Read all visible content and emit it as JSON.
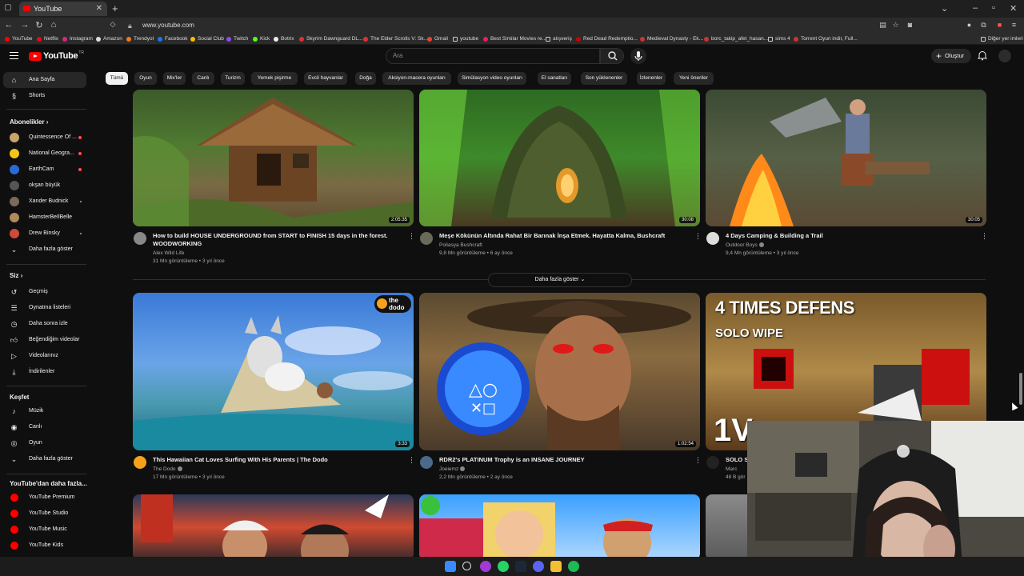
{
  "browser": {
    "tab_title": "YouTube",
    "url": "www.youtube.com",
    "bookmarks": [
      "YouTube",
      "Netflix",
      "Instagram",
      "Amazon",
      "Trendyol",
      "Facebook",
      "Social Club",
      "Twitch",
      "Kick",
      "Botrix",
      "Skyrim Dawnguard DL...",
      "The Elder Scrolls V: Sk...",
      "Gmail",
      "youtube",
      "Best Similar Movies re...",
      "alışveriş",
      "Red Dead Redemptio...",
      "Medieval Dynasty - Ek...",
      "borc_takip_afet_hasan...",
      "sims 4",
      "Torrent Oyun indir, Full..."
    ],
    "other_bookmarks": "Diğer yer imleri"
  },
  "header": {
    "logo": "YouTube",
    "logo_tr": "TR",
    "search_placeholder": "Ara",
    "create_label": "Oluştur"
  },
  "sidebar": {
    "home": "Ana Sayfa",
    "shorts": "Shorts",
    "subscriptions_title": "Abonelikler",
    "subscriptions": [
      {
        "name": "Quintessence Of ...",
        "color": "#c9a46a",
        "live": true
      },
      {
        "name": "National Geogra...",
        "color": "#f5c518",
        "live": true
      },
      {
        "name": "EarthCam",
        "color": "#2a6ad6",
        "live": true
      },
      {
        "name": "okşan büyük",
        "color": "#555555",
        "live": false
      },
      {
        "name": "Xander Budnick",
        "color": "#7a6a5a",
        "live": false
      },
      {
        "name": "HamsterBeIlBelle",
        "color": "#b08a5a",
        "live": false
      },
      {
        "name": "Drew Binsky",
        "color": "#d04a3a",
        "live": false
      }
    ],
    "show_more_subs": "Daha fazla göster",
    "you_title": "Siz",
    "you_items": [
      "Geçmiş",
      "Oynatma listeleri",
      "Daha sonra izle",
      "Beğendiğim videolar",
      "Videolarınız",
      "İndirilenler"
    ],
    "explore_title": "Keşfet",
    "explore_items": [
      "Müzik",
      "Canlı",
      "Oyun"
    ],
    "show_more_explore": "Daha fazla göster",
    "more_title": "YouTube'dan daha fazla...",
    "more_items": [
      "YouTube Premium",
      "YouTube Studio",
      "YouTube Music",
      "YouTube Kids"
    ]
  },
  "chips": [
    "Tümü",
    "Oyun",
    "Mix'ler",
    "Canlı",
    "Turizm",
    "Yemek pişirme",
    "Evcil hayvanlar",
    "Doğa",
    "Aksiyon-macera oyunları",
    "Simülasyon video oyunları",
    "El sanatları",
    "Son yüklenenler",
    "İzlenenler",
    "Yeni öneriler"
  ],
  "videos_row1": [
    {
      "title_line1": "How to build HOUSE UNDERGROUND from START to FINISH 15 days in the forest.",
      "title_line2": "WOODWORKING",
      "channel": "Alex Wild Life",
      "meta": "31 Mn görüntüleme • 3 yıl önce",
      "duration": "2:05:35"
    },
    {
      "title_line1": "Meşe Kökünün Altında Rahat Bir Barınak İnşa Etmek. Hayatta Kalma, Bushcraft",
      "title_line2": "",
      "channel": "Poliasya Bushcraft",
      "meta": "9,8 Mn görüntüleme • 6 ay önce",
      "duration": "30:08"
    },
    {
      "title_line1": "4 Days Camping & Building a Trail",
      "title_line2": "",
      "channel": "Outdoor Boys",
      "meta": "9,4 Mn görüntüleme • 3 yıl önce",
      "duration": "30:05"
    }
  ],
  "show_more_videos": "Daha fazla göster",
  "videos_row2": [
    {
      "title_line1": "This Hawaiian Cat Loves Surfing With His Parents | The Dodo",
      "channel": "The Dodo",
      "meta": "17 Mn görüntüleme • 3 yıl önce",
      "duration": "3:33",
      "badge": "the dodo"
    },
    {
      "title_line1": "RDR2's PLATINUM Trophy is an INSANE JOURNEY",
      "channel": "Joeiemz",
      "meta": "2,2 Mn görüntüleme • 2 ay önce",
      "duration": "1:02:54"
    },
    {
      "title_line1": "SOLO SI",
      "channel": "Marc",
      "meta": "48 B gör",
      "duration": "",
      "thumb_text1": "4 TIMES DEFENS",
      "thumb_text2": "SOLO WIPE",
      "thumb_text3": "1V"
    }
  ]
}
